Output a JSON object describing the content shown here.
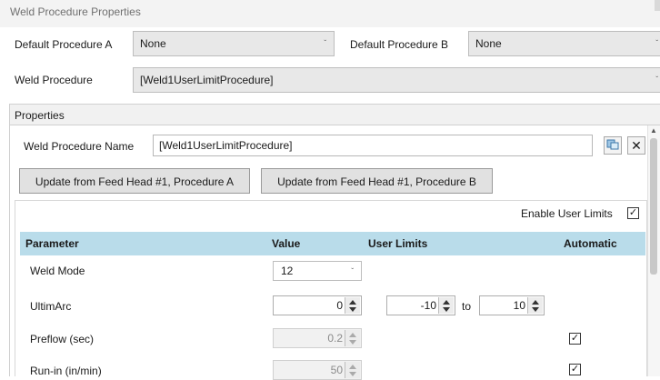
{
  "window": {
    "title": "Weld Procedure Properties"
  },
  "defaults": {
    "proc_a_label": "Default Procedure A",
    "proc_a_value": "None",
    "proc_b_label": "Default Procedure B",
    "proc_b_value": "None"
  },
  "weld_procedure": {
    "label": "Weld Procedure",
    "value": "[Weld1UserLimitProcedure]"
  },
  "properties": {
    "header": "Properties",
    "name_label": "Weld Procedure Name",
    "name_value": "[Weld1UserLimitProcedure]",
    "update_a_label": "Update from Feed Head #1, Procedure A",
    "update_b_label": "Update from Feed Head #1, Procedure B",
    "enable_user_limits_label": "Enable User Limits",
    "enable_user_limits_checked": true
  },
  "table": {
    "columns": [
      "Parameter",
      "Value",
      "User Limits",
      "Automatic"
    ],
    "to_label": "to",
    "rows": [
      {
        "parameter": "Weld Mode",
        "value": "12",
        "type": "select"
      },
      {
        "parameter": "UltimArc",
        "value": "0",
        "limit_min": "-10",
        "limit_max": "10",
        "type": "numeric"
      },
      {
        "parameter": "Preflow (sec)",
        "value": "0.2",
        "automatic": true,
        "type": "numeric-disabled"
      },
      {
        "parameter": "Run-in (in/min)",
        "value": "50",
        "automatic": true,
        "type": "numeric-disabled"
      }
    ]
  },
  "icons": {
    "copy": "copy-icon",
    "close": "close-icon",
    "dropdown": "chevron-down-icon",
    "check": "checkmark-icon"
  }
}
